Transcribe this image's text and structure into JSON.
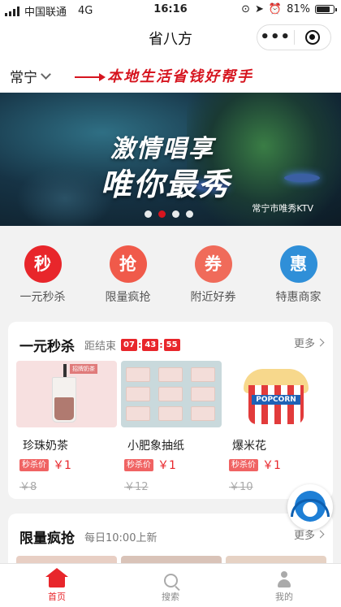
{
  "status": {
    "carrier": "中国联通",
    "network": "4G",
    "time": "16:16",
    "battery": "81%"
  },
  "header": {
    "title": "省八方",
    "more_glyph": "•••"
  },
  "location": {
    "city": "常宁",
    "slogan": "本地生活省钱好帮手"
  },
  "banner": {
    "line1": "激情唱享",
    "line2": "唯你最秀",
    "caption": "常宁市唯秀KTV",
    "slide_count": 4,
    "active_slide": 1
  },
  "quick": [
    {
      "char": "秒",
      "label": "一元秒杀",
      "color": "#e8262b",
      "icon": "flash-sale-icon"
    },
    {
      "char": "抢",
      "label": "限量疯抢",
      "color": "#f05a4a",
      "icon": "grab-icon"
    },
    {
      "char": "券",
      "label": "附近好券",
      "color": "#f06b5a",
      "icon": "coupon-icon"
    },
    {
      "char": "惠",
      "label": "特惠商家",
      "color": "#2f8fd8",
      "icon": "discount-icon"
    }
  ],
  "flash": {
    "title": "一元秒杀",
    "countdown_label": "距结束",
    "countdown": [
      "07",
      "43",
      "55"
    ],
    "more": "更多",
    "products": [
      {
        "name": "珍珠奶茶",
        "tag": "秒杀价",
        "price": "￥1",
        "orig": "￥8",
        "image": "milk-tea-image"
      },
      {
        "name": "小肥象抽纸",
        "tag": "秒杀价",
        "price": "￥1",
        "orig": "￥12",
        "image": "tissue-image"
      },
      {
        "name": "爆米花",
        "tag": "秒杀价",
        "price": "￥1",
        "orig": "￥10",
        "image": "popcorn-image"
      }
    ],
    "tea_label": "招牌奶茶",
    "popcorn_brand": "POPCORN"
  },
  "limited": {
    "title": "限量疯抢",
    "sub": "每日10:00上新",
    "more": "更多"
  },
  "tabbar": [
    {
      "label": "首页",
      "active": true,
      "icon": "home-icon"
    },
    {
      "label": "搜索",
      "active": false,
      "icon": "search-icon"
    },
    {
      "label": "我的",
      "active": false,
      "icon": "user-icon"
    }
  ]
}
